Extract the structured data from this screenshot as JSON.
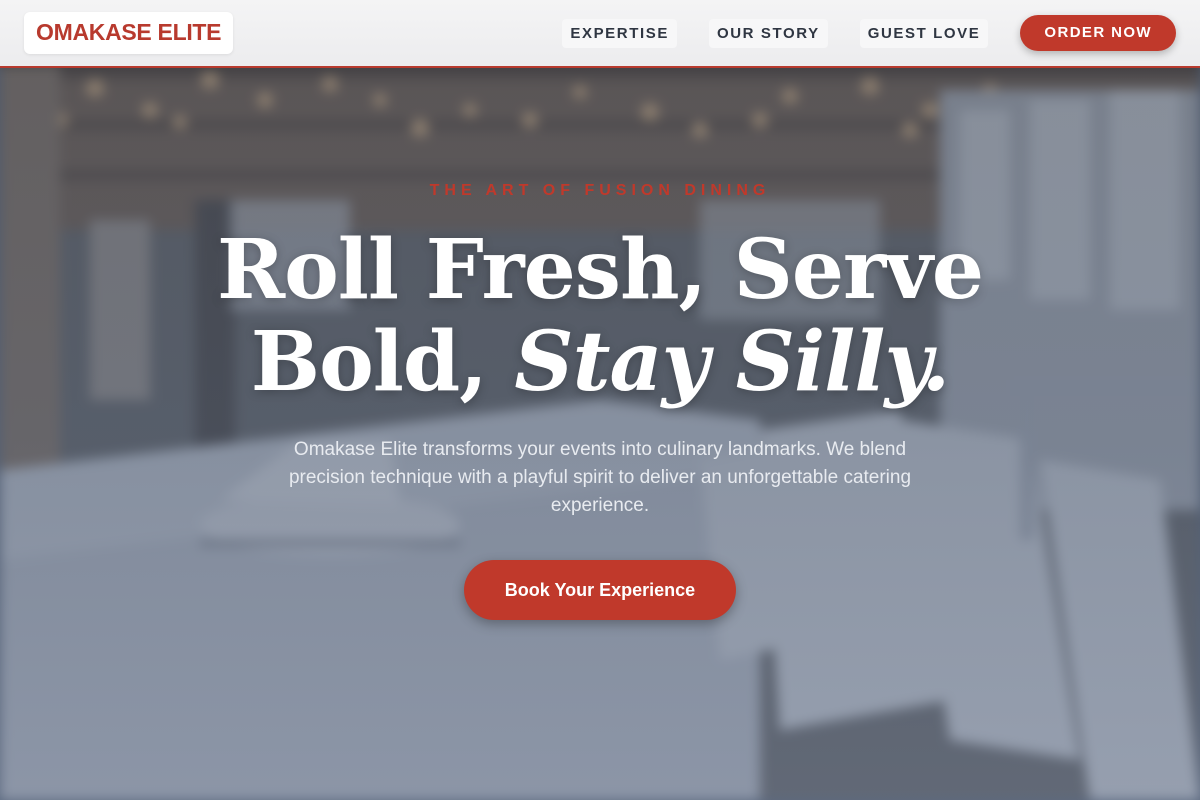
{
  "brand": {
    "logo_text": "OMAKASE ELITE",
    "accent_color": "#c0392b"
  },
  "nav": {
    "links": [
      {
        "label": "EXPERTISE"
      },
      {
        "label": "OUR STORY"
      },
      {
        "label": "GUEST LOVE"
      }
    ],
    "order_label": "ORDER NOW"
  },
  "hero": {
    "eyebrow": "THE ART OF FUSION DINING",
    "headline_line1": "Roll Fresh, Serve",
    "headline_line2_plain": "Bold, ",
    "headline_line2_italic": "Stay Silly.",
    "subtitle": "Omakase Elite transforms your events into culinary landmarks. We blend precision technique with a playful spirit to deliver an unforgettable catering experience.",
    "cta_label": "Book Your Experience"
  },
  "background": {
    "image": "blurred banquet hall with long white-clothed table and white folding chairs"
  }
}
